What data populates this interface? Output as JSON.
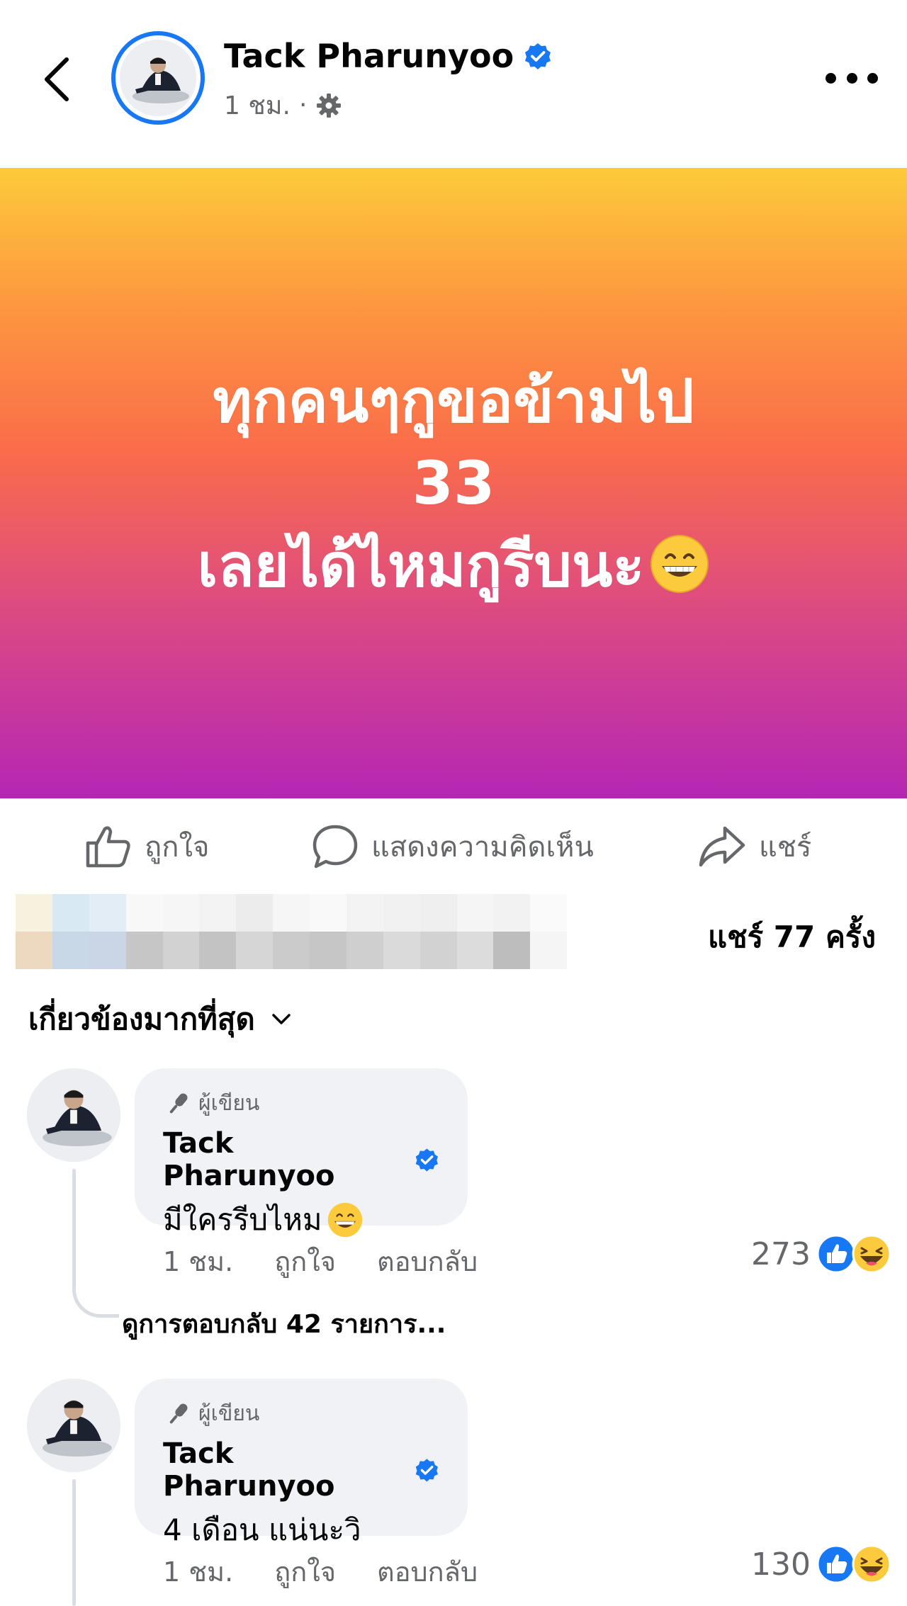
{
  "header": {
    "author_name": "Tack Pharunyoo",
    "time": "1 ชม.",
    "separator": "·"
  },
  "post": {
    "line1": "ทุกคนๆกูขอข้ามไป",
    "line2": "33",
    "line3": "เลยได้ไหมกูรีบนะ",
    "line3_emoji": "grinning-face-emoji",
    "gradient_colors": [
      "#fdcb3a",
      "#fd9640",
      "#fa6c4a",
      "#df4d7e",
      "#b526b5"
    ]
  },
  "actions": {
    "like_label": "ถูกใจ",
    "comment_label": "แสดงความคิดเห็น",
    "share_label": "แชร์"
  },
  "stats": {
    "shares": "แชร์ 77 ครั้ง"
  },
  "sort": {
    "label": "เกี่ยวข้องมากที่สุด"
  },
  "comments": [
    {
      "badge": "ผู้เขียน",
      "author": "Tack Pharunyoo",
      "text": "มีใครรีบไหม",
      "time": "1 ชม.",
      "like_label": "ถูกใจ",
      "reply_label": "ตอบกลับ",
      "reaction_count": "273",
      "view_replies": "ดูการตอบกลับ 42 รายการ..."
    },
    {
      "badge": "ผู้เขียน",
      "author": "Tack Pharunyoo",
      "text": "4 เดือน แน่นะวิ",
      "time": "1 ชม.",
      "like_label": "ถูกใจ",
      "reply_label": "ตอบกลับ",
      "reaction_count": "130"
    }
  ],
  "colors": {
    "verified_blue": "#1877f2",
    "secondary_text": "#65676b",
    "bubble_bg": "#f0f2f5",
    "haha_yellow": "#fbcb3d"
  }
}
